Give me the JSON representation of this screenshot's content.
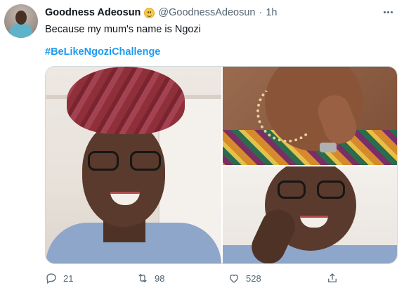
{
  "tweet": {
    "author_name": "Goodness Adeosun",
    "author_handle": "@GoodnessAdeosun",
    "separator": "·",
    "time": "1h",
    "text": "Because my mum's name is Ngozi",
    "hashtag": "#BeLikeNgoziChallenge",
    "author_emoji": "smiling-face",
    "accent_color": "#1d9bf0"
  },
  "actions": {
    "reply_count": "21",
    "retweet_count": "98",
    "like_count": "528"
  },
  "icons": [
    "avatar",
    "emoji",
    "more-icon",
    "reply-icon",
    "retweet-icon",
    "like-icon",
    "share-icon"
  ]
}
